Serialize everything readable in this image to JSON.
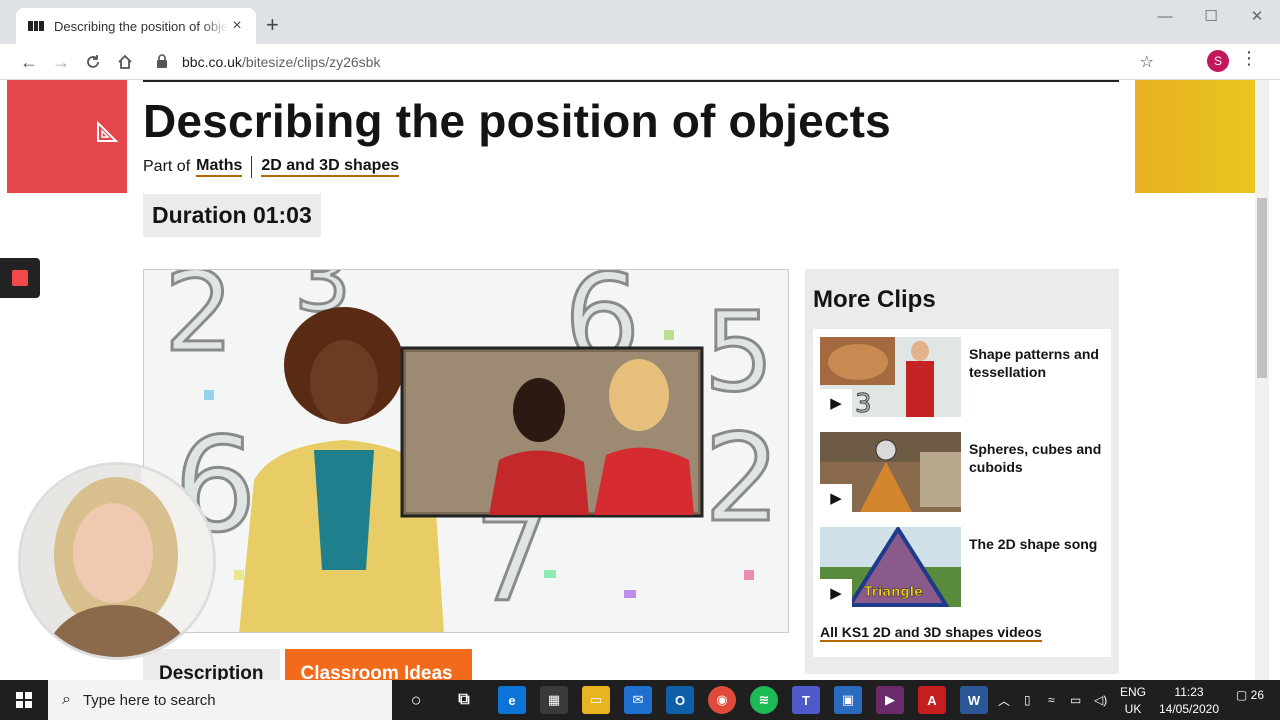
{
  "browser": {
    "tab_title": "Describing the position of objects",
    "tab_close": "×",
    "new_tab": "+",
    "url_host": "bbc.co.uk",
    "url_path": "/bitesize/clips/zy26sbk",
    "profile_initial": "S",
    "window_controls": [
      "—",
      "☐",
      "✕"
    ]
  },
  "page": {
    "title": "Describing the position of objects",
    "part_of_label": "Part of",
    "breadcrumbs": [
      "Maths",
      "2D and 3D shapes"
    ],
    "duration": "Duration 01:03",
    "tabs": [
      "Description",
      "Classroom Ideas"
    ],
    "colors": {
      "accent_red": "#e5464d",
      "accent_yellow": "#e9c620",
      "tab_orange": "#f26b1d"
    }
  },
  "more_clips": {
    "heading": "More Clips",
    "items": [
      {
        "label": "Shape patterns and tessellation"
      },
      {
        "label": "Spheres, cubes and cuboids"
      },
      {
        "label": "The 2D shape song",
        "thumb_text": "Triangle"
      }
    ],
    "all_link": "All KS1 2D and 3D shapes videos"
  },
  "taskbar": {
    "search_placeholder": "Type here to search",
    "lang_top": "ENG",
    "lang_bottom": "UK",
    "time": "11:23",
    "date": "14/05/2020",
    "notifications": "26"
  }
}
